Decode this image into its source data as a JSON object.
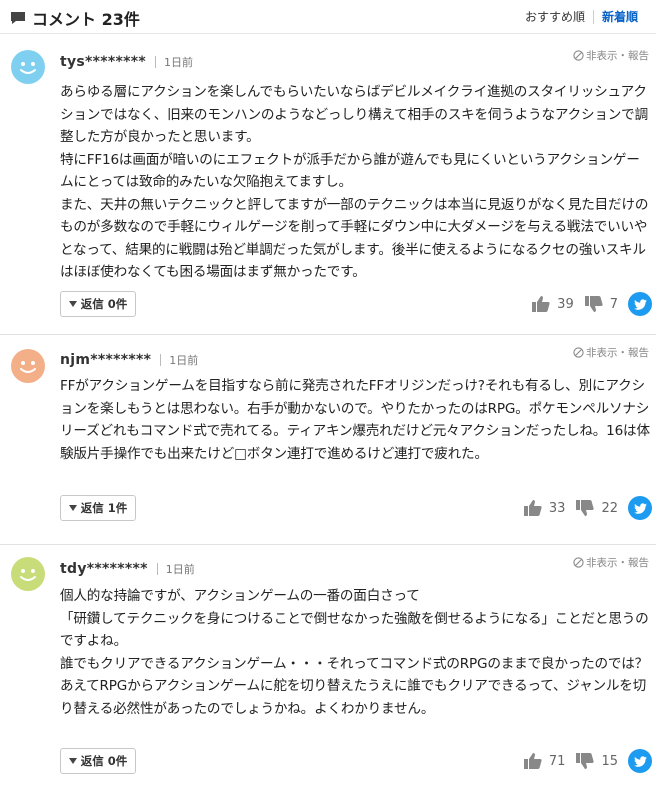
{
  "header": {
    "title": "コメント 23件",
    "sort_recommended": "おすすめ順",
    "sort_newest": "新着順"
  },
  "comments": [
    {
      "user": "tys********",
      "time": "1日前",
      "hide_report": "非表示・報告",
      "avatar_color": "#7fd0f0",
      "text": "あらゆる層にアクションを楽しんでもらいたいならばデビルメイクライ進拠のスタイリッシュアクションではなく、旧来のモンハンのようなどっしり構えて相手のスキを伺うようなアクションで調整した方が良かったと思います。\n特にFF16は画面が暗いのにエフェクトが派手だから誰が遊んでも見にくいというアクションゲームにとっては致命的みたいな欠陥抱えてますし。\nまた、天井の無いテクニックと評してますが一部のテクニックは本当に見返りがなく見た目だけのものが多数なので手軽にウィルゲージを削って手軽にダウン中に大ダメージを与える戦法でいいやとなって、結果的に戦闘は殆ど単調だった気がします。後半に使えるようになるクセの強いスキルはほぼ使わなくても困る場面はまず無かったです。",
      "reply": "返信 0件",
      "likes": "39",
      "dislikes": "7"
    },
    {
      "user": "njm********",
      "time": "1日前",
      "hide_report": "非表示・報告",
      "avatar_color": "#f3b088",
      "text": "FFがアクションゲームを目指すなら前に発売されたFFオリジンだっけ?それも有るし、別にアクションを楽しもうとは思わない。右手が動かないので。やりたかったのはRPG。ポケモンペルソナシリーズどれもコマンド式で売れてる。ティアキン爆売れだけど元々アクションだったしね。16は体験版片手操作でも出来たけど□ボタン連打で進めるけど連打で疲れた。",
      "reply": "返信 1件",
      "likes": "33",
      "dislikes": "22"
    },
    {
      "user": "tdy********",
      "time": "1日前",
      "hide_report": "非表示・報告",
      "avatar_color": "#c9dc7a",
      "text": "個人的な持論ですが、アクションゲームの一番の面白さって\n「研鑽してテクニックを身につけることで倒せなかった強敵を倒せるようになる」ことだと思うのですよね。\n誰でもクリアできるアクションゲーム・・・それってコマンド式のRPGのままで良かったのでは？\nあえてRPGからアクションゲームに舵を切り替えたうえに誰でもクリアできるって、ジャンルを切り替える必然性があったのでしょうかね。よくわかりません。",
      "reply": "返信 0件",
      "likes": "71",
      "dislikes": "15"
    }
  ]
}
